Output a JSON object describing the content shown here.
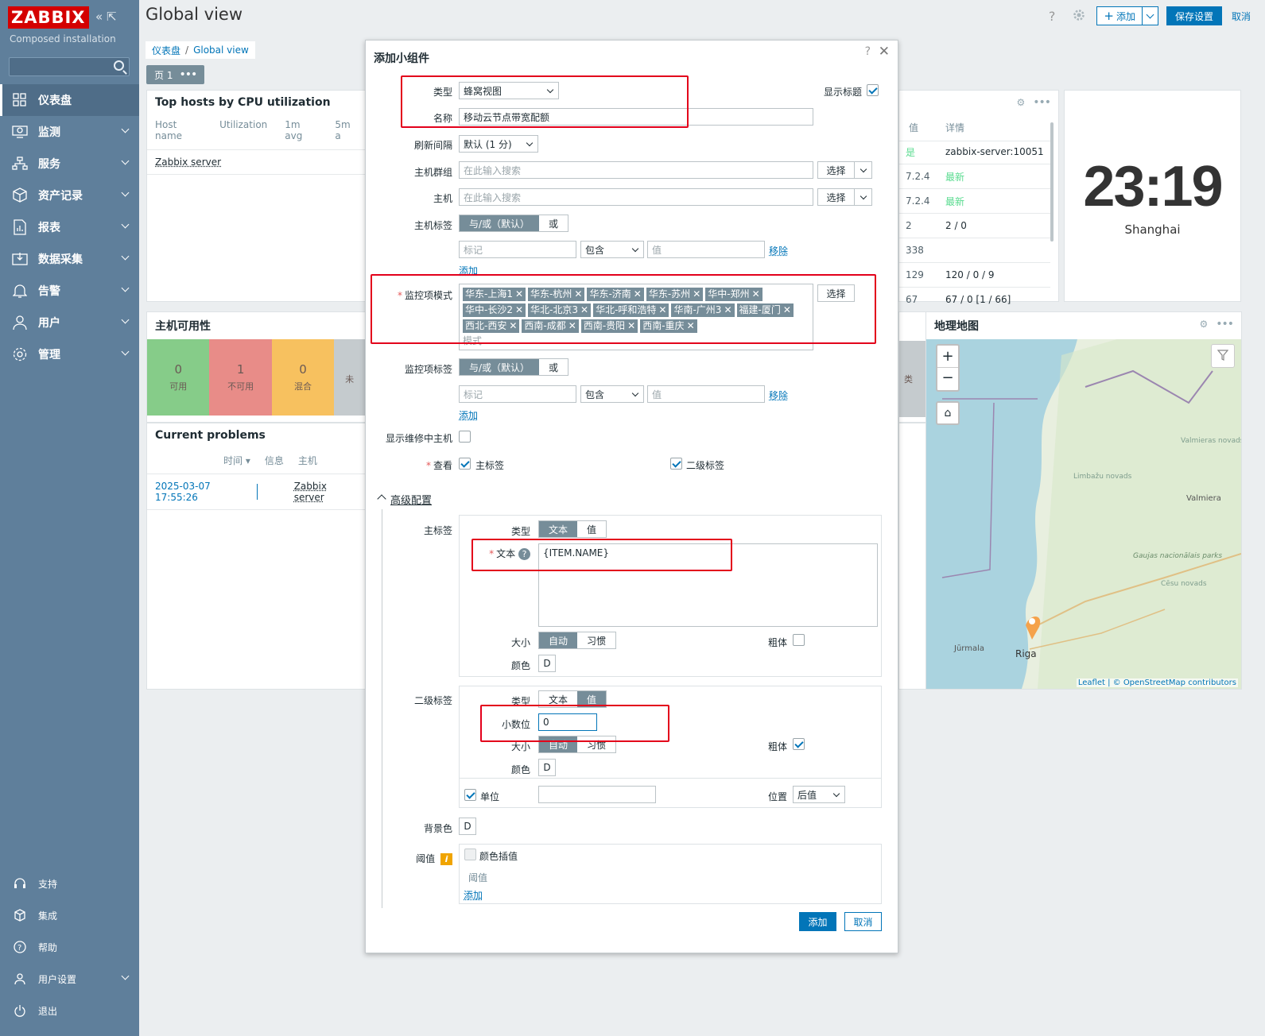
{
  "sidebar": {
    "logo": "ZABBIX",
    "subtitle": "Composed installation",
    "items": [
      {
        "label": "仪表盘",
        "icon": "dashboard-icon"
      },
      {
        "label": "监测",
        "icon": "monitoring-icon"
      },
      {
        "label": "服务",
        "icon": "services-icon"
      },
      {
        "label": "资产记录",
        "icon": "inventory-icon"
      },
      {
        "label": "报表",
        "icon": "reports-icon"
      },
      {
        "label": "数据采集",
        "icon": "data-collection-icon"
      },
      {
        "label": "告警",
        "icon": "alerts-icon"
      },
      {
        "label": "用户",
        "icon": "users-icon"
      },
      {
        "label": "管理",
        "icon": "administration-icon"
      }
    ],
    "bottom": [
      {
        "label": "支持"
      },
      {
        "label": "集成"
      },
      {
        "label": "帮助"
      },
      {
        "label": "用户设置"
      },
      {
        "label": "退出"
      }
    ]
  },
  "header": {
    "title": "Global view",
    "add_label": "添加",
    "save_label": "保存设置",
    "cancel_label": "取消"
  },
  "breadcrumb": {
    "root": "仪表盘",
    "current": "Global view"
  },
  "page_tab": "页 1",
  "top_hosts": {
    "title": "Top hosts by CPU utilization",
    "columns": [
      "Host name",
      "Utilization",
      "1m avg",
      "5m a"
    ],
    "row": "Zabbix server"
  },
  "right_table": {
    "columns": [
      "值",
      "详情"
    ],
    "rows": [
      {
        "v": "是",
        "d": "zabbix-server:10051"
      },
      {
        "v": "7.2.4",
        "d": "最新"
      },
      {
        "v": "7.2.4",
        "d": "最新"
      },
      {
        "v": "2",
        "d": "2 / 0"
      },
      {
        "v": "338",
        "d": ""
      },
      {
        "v": "129",
        "d": "120 / 0 / 9"
      },
      {
        "v": "67",
        "d": "67 / 0 [1 / 66]"
      }
    ]
  },
  "clock": {
    "time": "23:19",
    "city": "Shanghai"
  },
  "availability": {
    "title": "主机可用性",
    "cells": [
      {
        "n": "0",
        "l": "可用"
      },
      {
        "n": "1",
        "l": "不可用"
      },
      {
        "n": "0",
        "l": "混合"
      },
      {
        "n": "",
        "l": "未"
      }
    ],
    "side_label": "类"
  },
  "map": {
    "title": "地理地图",
    "labels": [
      "Valmieras novads",
      "Limbažu novads",
      "Valmiera",
      "Gaujas nacionālais parks",
      "Cēsu novads",
      "Jūrmala",
      "Riga"
    ],
    "attribution": "Leaflet | © OpenStreetMap contributors"
  },
  "problems": {
    "title": "Current problems",
    "columns": [
      "时间 ▾",
      "信息",
      "主机"
    ],
    "row": {
      "time": "2025-03-07 17:55:26",
      "host": "Zabbix server"
    }
  },
  "dialog": {
    "title": "添加小组件",
    "type_label": "类型",
    "type_value": "蜂窝视图",
    "show_title_label": "显示标题",
    "name_label": "名称",
    "name_value": "移动云节点带宽配额",
    "refresh_label": "刷新间隔",
    "refresh_value": "默认 (1 分)",
    "hostgroup_label": "主机群组",
    "host_label": "主机",
    "search_placeholder": "在此输入搜索",
    "select_label": "选择",
    "hosttag_label": "主机标签",
    "andor_label": "与/或（默认）",
    "or_label": "或",
    "tag_placeholder": "标记",
    "contains_label": "包含",
    "value_placeholder": "值",
    "remove_label": "移除",
    "add_label": "添加",
    "item_pattern_label": "监控项模式",
    "item_patterns": [
      "华东-上海1",
      "华东-杭州",
      "华东-济南",
      "华东-苏州",
      "华中-郑州",
      "华中-长沙2",
      "华北-北京3",
      "华北-呼和浩特",
      "华南-广州3",
      "福建-厦门",
      "西北-西安",
      "西南-成都",
      "西南-贵阳",
      "西南-重庆"
    ],
    "pattern_placeholder": "模式",
    "itemtag_label": "监控项标签",
    "maint_label": "显示维修中主机",
    "view_label": "查看",
    "primary_label_cb": "主标签",
    "secondary_label_cb": "二级标签",
    "advanced_label": "高级配置",
    "primary_section": "主标签",
    "secondary_section": "二级标签",
    "type_sub": "类型",
    "text_label": "文本",
    "value_label": "值",
    "text_value": "{ITEM.NAME}",
    "size_label": "大小",
    "auto_label": "自动",
    "custom_label": "习惯",
    "bold_label": "粗体",
    "color_label": "颜色",
    "color_value": "D",
    "decimals_label": "小数位",
    "decimals_value": "0",
    "unit_label": "单位",
    "position_label": "位置",
    "position_value": "后值",
    "bg_label": "背景色",
    "threshold_label": "阈值",
    "color_interp_label": "颜色插值",
    "threshold_col": "阈值",
    "submit_label": "添加",
    "cancel_label": "取消"
  }
}
